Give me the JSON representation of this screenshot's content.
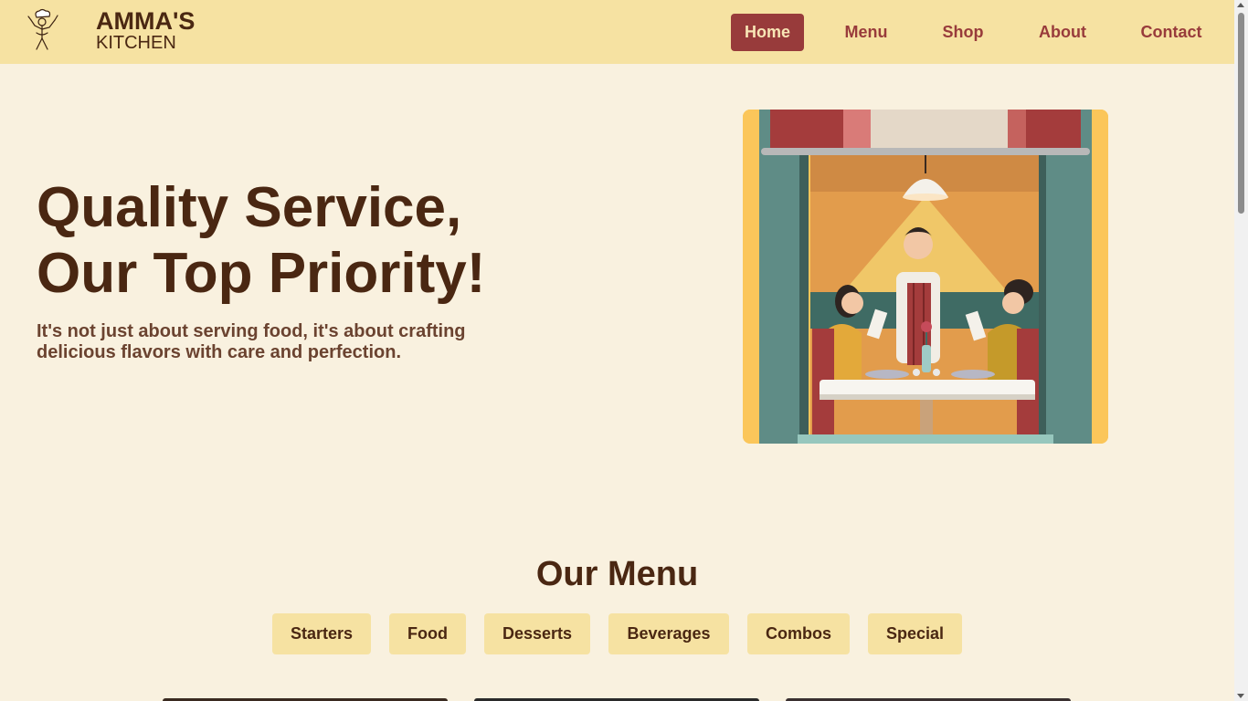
{
  "brand": {
    "title": "AMMA'S",
    "subtitle": "KITCHEN",
    "logo_icon": "chef-icon"
  },
  "nav": {
    "items": [
      {
        "label": "Home",
        "active": true
      },
      {
        "label": "Menu",
        "active": false
      },
      {
        "label": "Shop",
        "active": false
      },
      {
        "label": "About",
        "active": false
      },
      {
        "label": "Contact",
        "active": false
      }
    ]
  },
  "hero": {
    "title_line1": "Quality Service,",
    "title_line2": "Our Top Priority!",
    "subtitle": "It's not just about serving food, it's about crafting delicious flavors with care and perfection.",
    "image": "restaurant-waiter-illustration"
  },
  "menu_section": {
    "heading": "Our Menu",
    "categories": [
      "Starters",
      "Food",
      "Desserts",
      "Beverages",
      "Combos",
      "Special"
    ]
  },
  "colors": {
    "background": "#f9f1df",
    "navbar": "#f6e2a2",
    "accent": "#983b3b",
    "text_dark": "#4a2712"
  }
}
